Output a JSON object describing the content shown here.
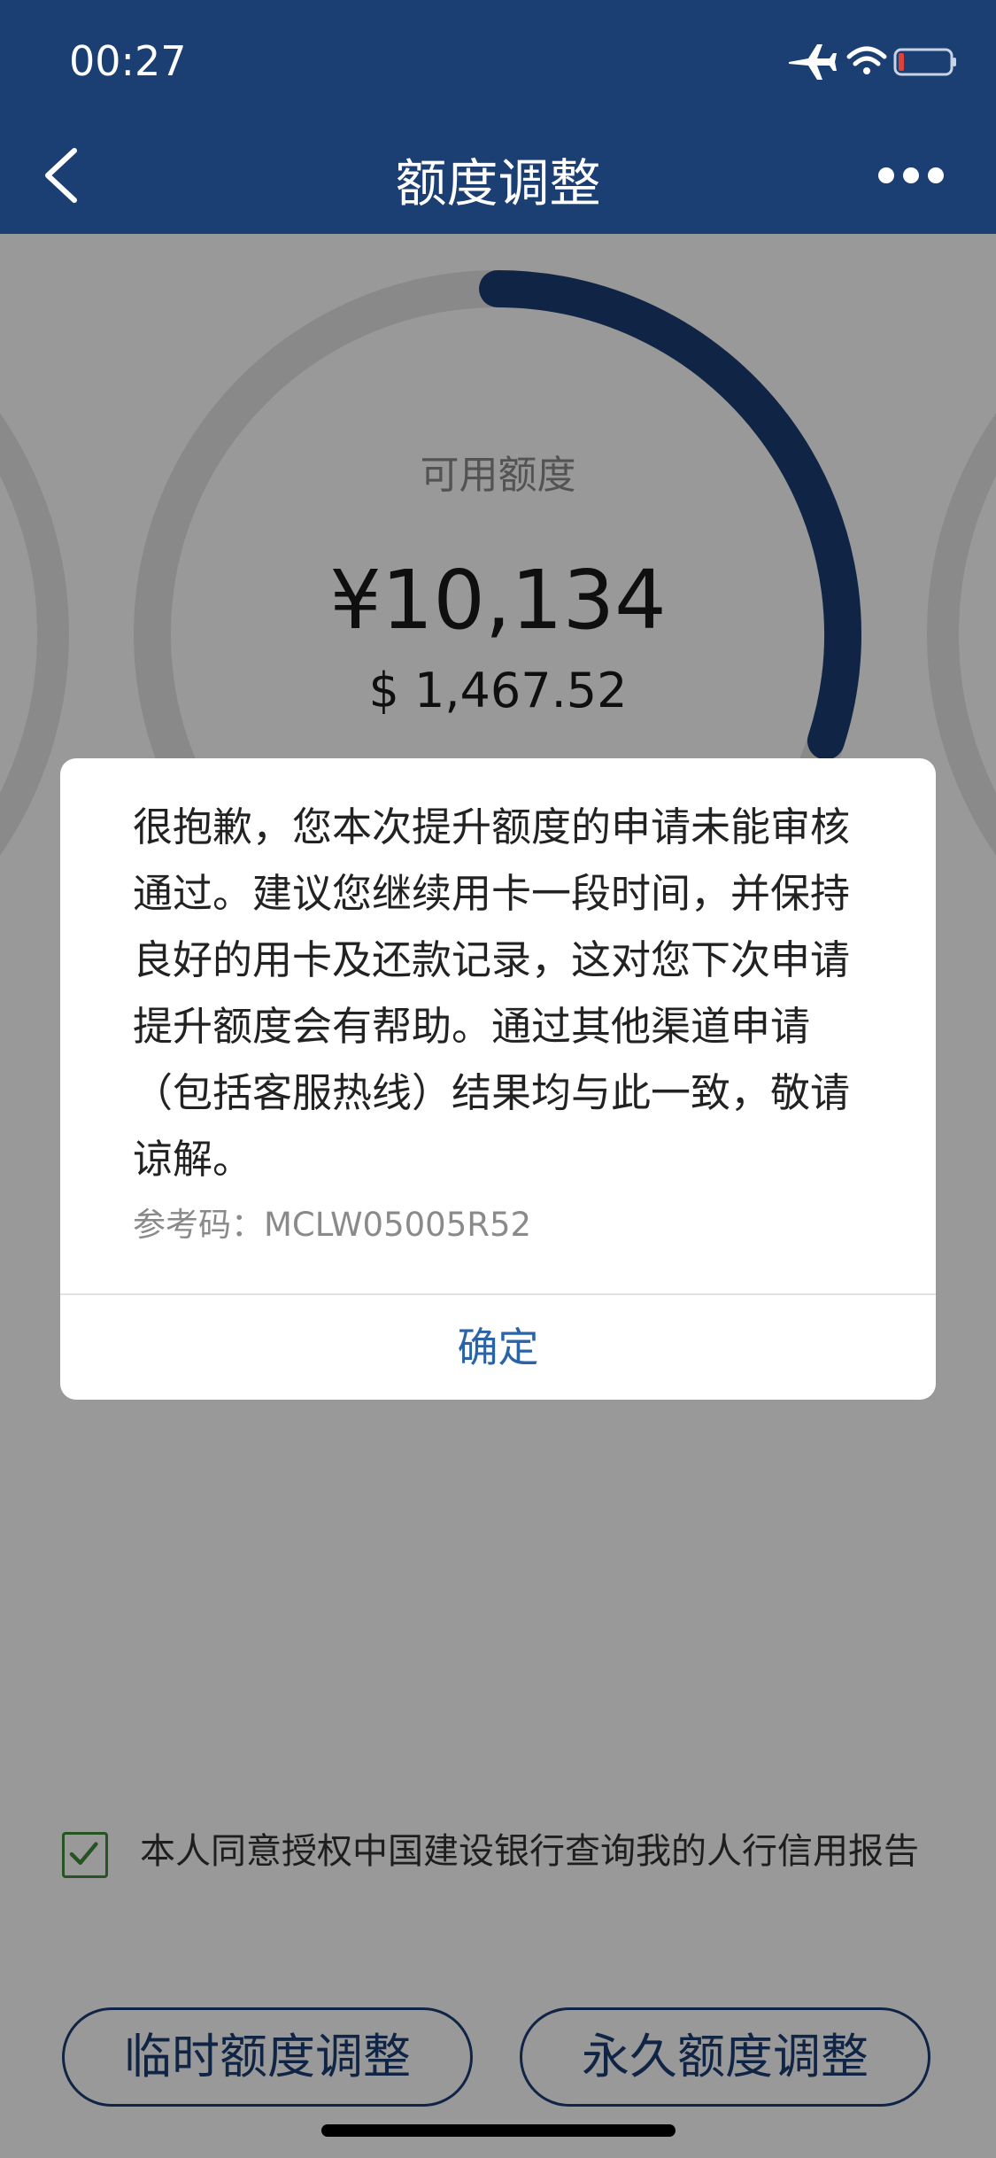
{
  "status_bar": {
    "time": "00:27"
  },
  "nav": {
    "title": "额度调整"
  },
  "credit": {
    "label": "可用额度",
    "cny": "¥10,134",
    "usd": "$ 1,467.52",
    "ring_fill_fraction": 0.3
  },
  "dialog": {
    "message": "很抱歉，您本次提升额度的申请未能审核通过。建议您继续用卡一段时间，并保持良好的用卡及还款记录，这对您下次申请提升额度会有帮助。通过其他渠道申请（包括客服热线）结果均与此一致，敬请谅解。",
    "ref_label": "参考码：",
    "ref_code": "MCLW05005R52",
    "ok_label": "确定"
  },
  "agreement": {
    "text": "本人同意授权中国建设银行查询我的人行信用报告",
    "checked": true
  },
  "buttons": {
    "temp": "临时额度调整",
    "perm": "永久额度调整"
  },
  "colors": {
    "primary": "#1b3e73",
    "link": "#2a63a8",
    "check": "#3e8b3a",
    "ring_track": "#e5e5e5"
  }
}
